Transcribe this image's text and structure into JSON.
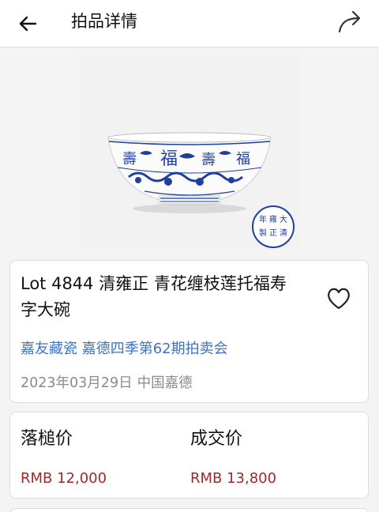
{
  "header": {
    "title": "拍品详情",
    "back_icon": "arrow-left-icon",
    "share_icon": "share-arrow-icon"
  },
  "image": {
    "subject": "blue-and-white porcelain bowl",
    "seal_marks": [
      "大",
      "清",
      "雍",
      "正",
      "年",
      "製"
    ]
  },
  "lot": {
    "title": "Lot 4844 清雍正  青花缠枝莲托福寿字大碗",
    "auction": "嘉友藏瓷 嘉德四季第62期拍卖会",
    "date": "2023年03月29日",
    "location": "中国嘉德",
    "favorite_icon": "heart-outline-icon"
  },
  "prices": {
    "hammer_label": "落槌价",
    "hammer_value": "RMB 12,000",
    "deal_label": "成交价",
    "deal_value": "RMB 13,800",
    "value_color": "#9b2b2b"
  },
  "colors": {
    "link": "#3b73c7",
    "muted": "#8a8a8a",
    "porcelain_blue": "#1f3f9c"
  }
}
